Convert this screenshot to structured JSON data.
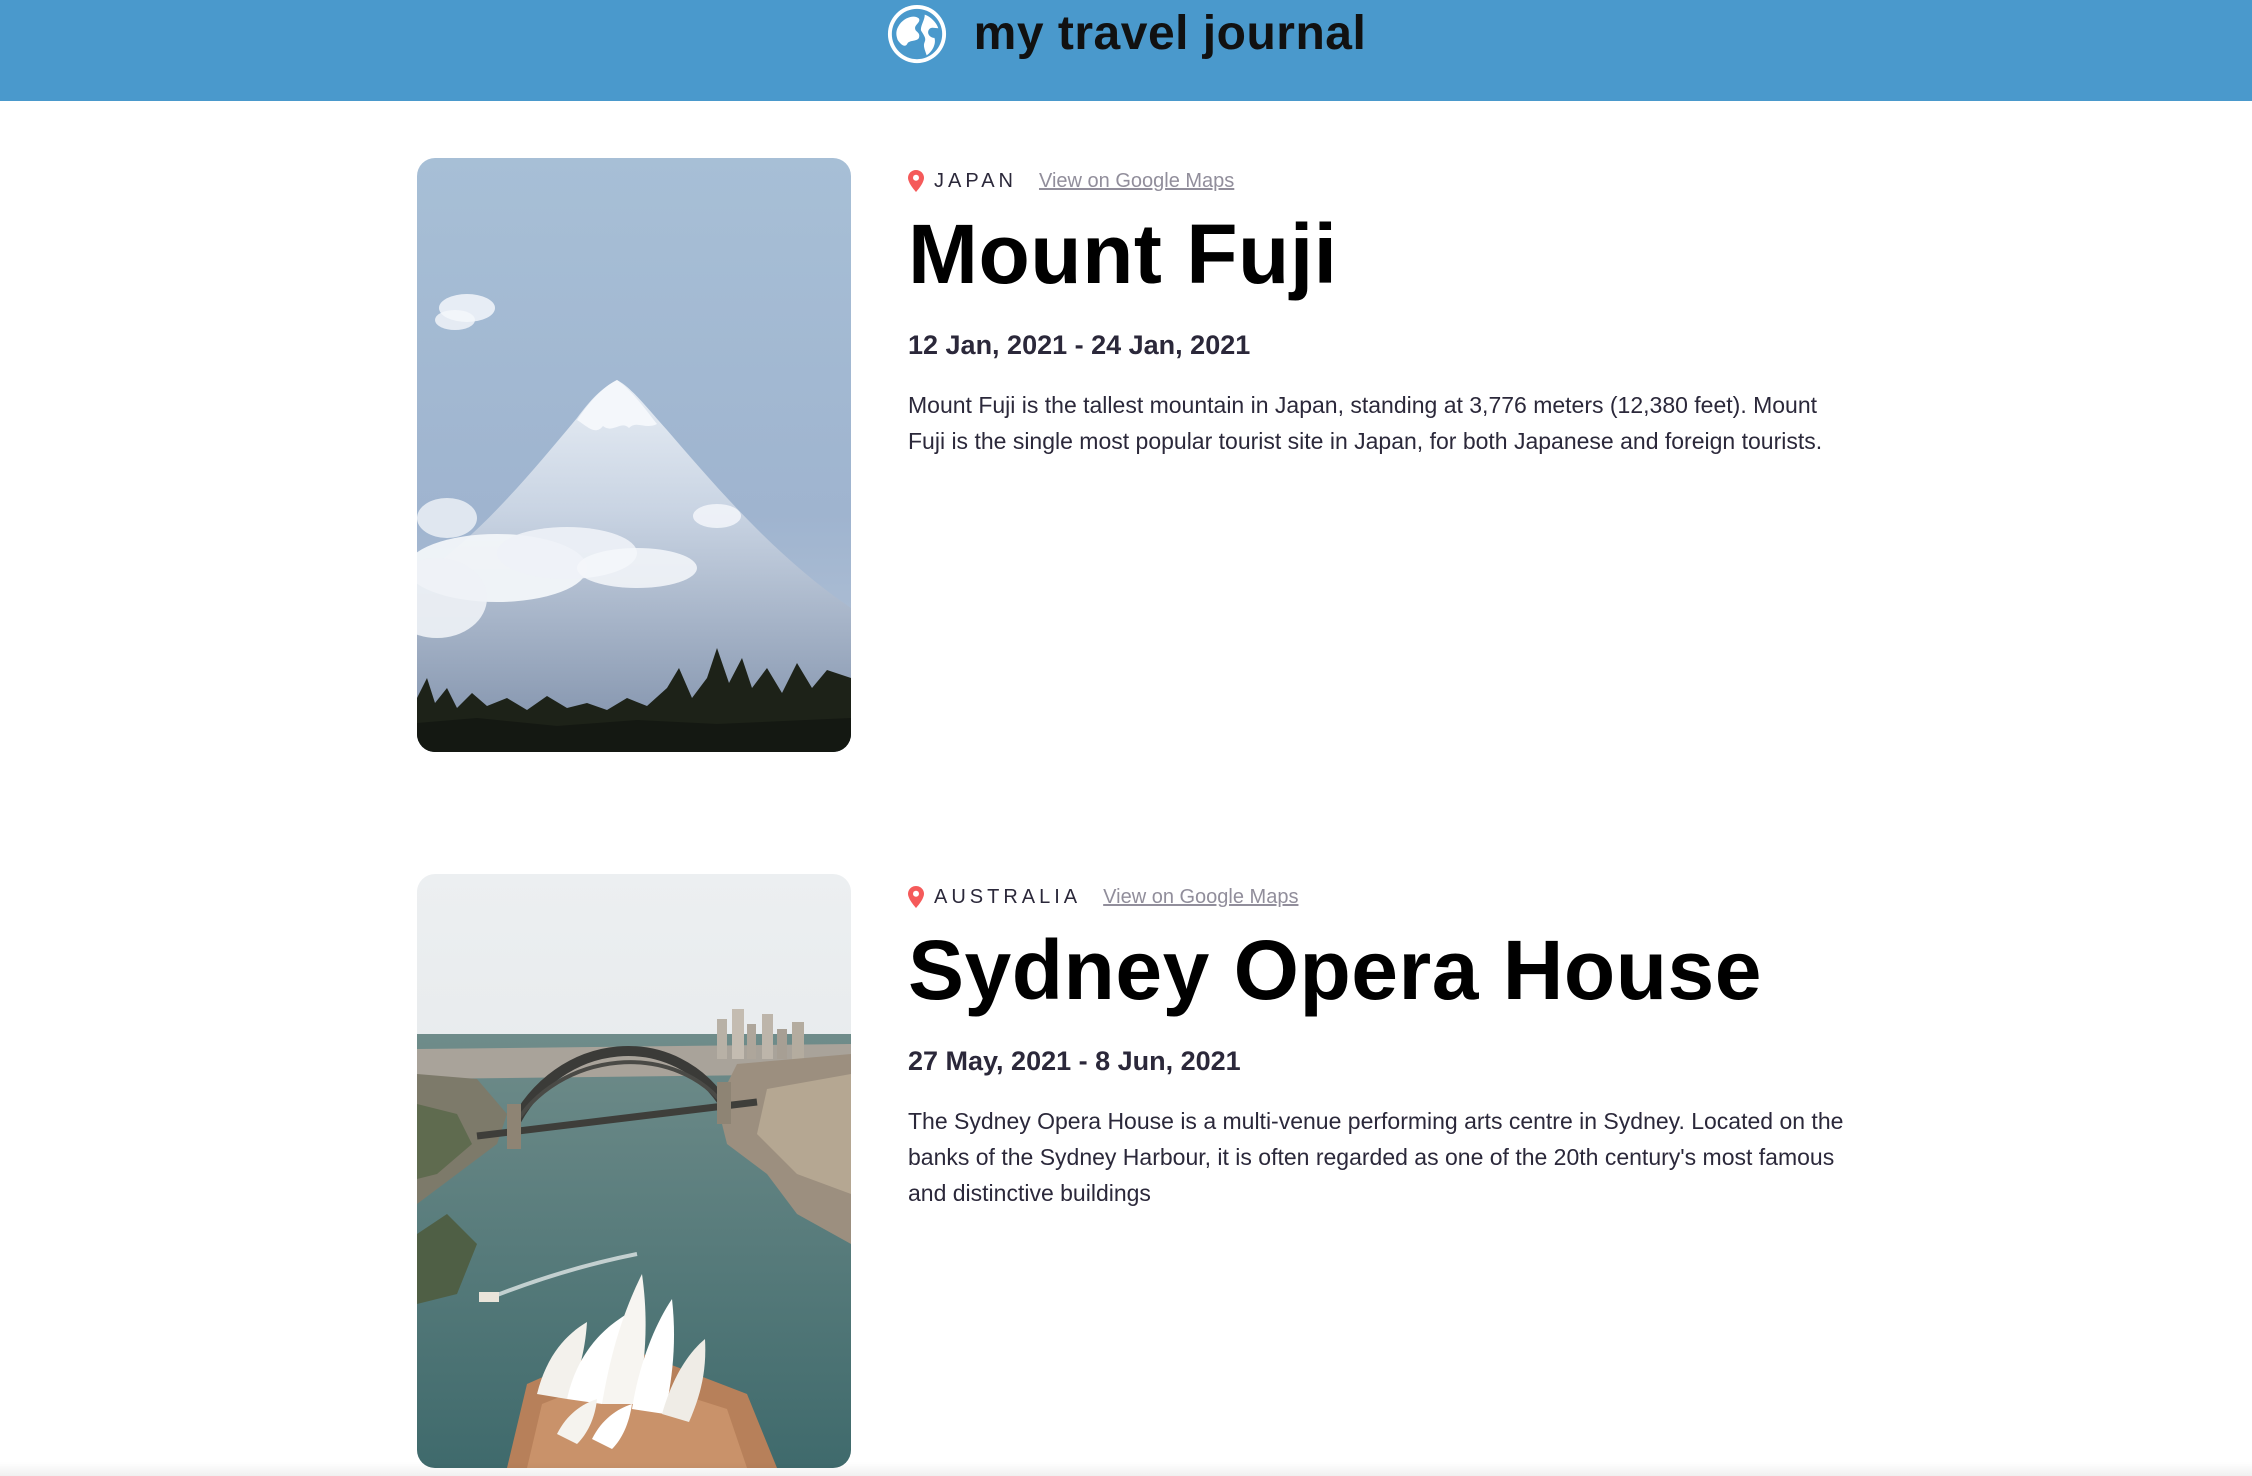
{
  "header": {
    "title": "my travel journal",
    "icon": "globe-icon",
    "background": "#4a99cc"
  },
  "entries": [
    {
      "country": "JAPAN",
      "maps_link": "View on Google Maps",
      "title": "Mount Fuji",
      "dates": "12 Jan, 2021 - 24 Jan, 2021",
      "description": "Mount Fuji is the tallest mountain in Japan, standing at 3,776 meters (12,380 feet). Mount Fuji is the single most popular tourist site in Japan, for both Japanese and foreign tourists.",
      "image": "mount-fuji-photo"
    },
    {
      "country": "AUSTRALIA",
      "maps_link": "View on Google Maps",
      "title": "Sydney Opera House",
      "dates": "27 May, 2021 - 8 Jun, 2021",
      "description": "The Sydney Opera House is a multi-venue performing arts centre in Sydney. Located on the banks of the Sydney Harbour, it is often regarded as one of the 20th century's most famous and distinctive buildings",
      "image": "sydney-opera-house-photo"
    }
  ],
  "colors": {
    "pin": "#f55a5a",
    "link": "#918e9b",
    "text": "#2b283a"
  }
}
